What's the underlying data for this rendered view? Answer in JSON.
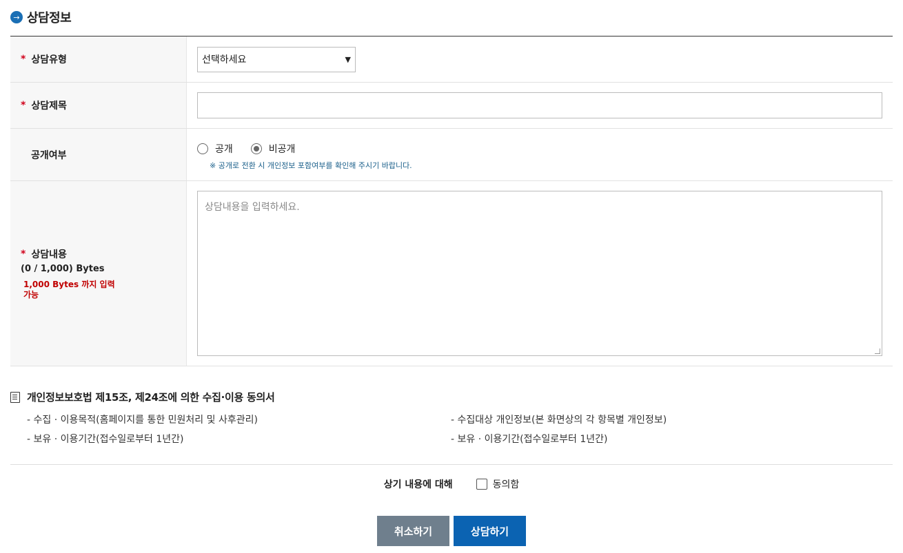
{
  "header": {
    "title": "상담정보",
    "icon": "arrow-right-circle-icon"
  },
  "form": {
    "type": {
      "label": "상담유형",
      "required": "*",
      "selected": "선택하세요"
    },
    "subject": {
      "label": "상담제목",
      "required": "*",
      "value": ""
    },
    "public": {
      "label": "공개여부",
      "options": [
        "공개",
        "비공개"
      ],
      "selected": "비공개",
      "notice": "※ 공개로 전환 시 개인정보 포함여부를 확인해 주시기 바랍니다."
    },
    "content": {
      "label": "상담내용",
      "required": "*",
      "bytes": "(0 / 1,000) Bytes",
      "limit": "1,000 Bytes 까지 입력 가능",
      "placeholder": "상담내용을 입력하세요."
    }
  },
  "consent": {
    "title": "개인정보보호법 제15조, 제24조에 의한 수집·이용 동의서",
    "items": [
      "- 수집 · 이용목적(홈페이지를 통한 민원처리 및 사후관리)",
      "- 수집대상 개인정보(본 화면상의 각 항목별 개인정보)",
      "- 보유 · 이용기간(접수일로부터 1년간)",
      "- 보유 · 이용기간(접수일로부터 1년간)"
    ],
    "agree_prompt": "상기 내용에 대해",
    "agree_label": "동의함"
  },
  "buttons": {
    "cancel": "취소하기",
    "submit": "상담하기"
  },
  "colors": {
    "accent": "#0b63b2",
    "required": "#d0021b",
    "cancel": "#6f7f8d"
  }
}
